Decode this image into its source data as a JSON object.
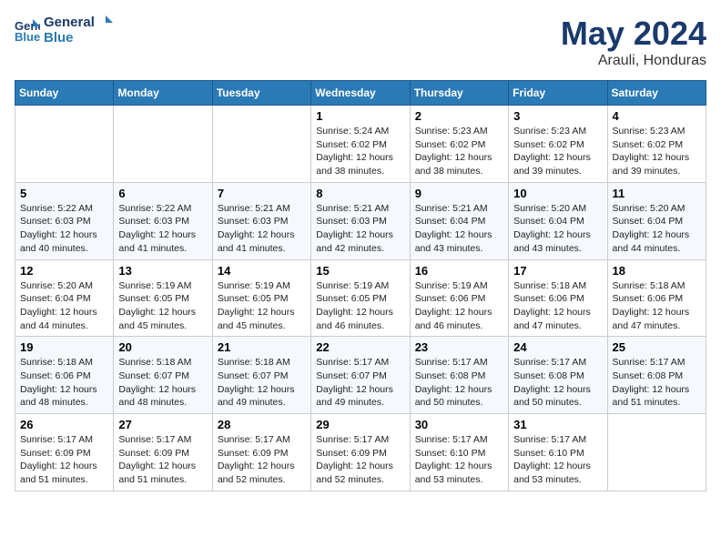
{
  "logo": {
    "line1": "General",
    "line2": "Blue"
  },
  "title": "May 2024",
  "subtitle": "Arauli, Honduras",
  "weekdays": [
    "Sunday",
    "Monday",
    "Tuesday",
    "Wednesday",
    "Thursday",
    "Friday",
    "Saturday"
  ],
  "weeks": [
    [
      {
        "day": "",
        "info": ""
      },
      {
        "day": "",
        "info": ""
      },
      {
        "day": "",
        "info": ""
      },
      {
        "day": "1",
        "info": "Sunrise: 5:24 AM\nSunset: 6:02 PM\nDaylight: 12 hours\nand 38 minutes."
      },
      {
        "day": "2",
        "info": "Sunrise: 5:23 AM\nSunset: 6:02 PM\nDaylight: 12 hours\nand 38 minutes."
      },
      {
        "day": "3",
        "info": "Sunrise: 5:23 AM\nSunset: 6:02 PM\nDaylight: 12 hours\nand 39 minutes."
      },
      {
        "day": "4",
        "info": "Sunrise: 5:23 AM\nSunset: 6:02 PM\nDaylight: 12 hours\nand 39 minutes."
      }
    ],
    [
      {
        "day": "5",
        "info": "Sunrise: 5:22 AM\nSunset: 6:03 PM\nDaylight: 12 hours\nand 40 minutes."
      },
      {
        "day": "6",
        "info": "Sunrise: 5:22 AM\nSunset: 6:03 PM\nDaylight: 12 hours\nand 41 minutes."
      },
      {
        "day": "7",
        "info": "Sunrise: 5:21 AM\nSunset: 6:03 PM\nDaylight: 12 hours\nand 41 minutes."
      },
      {
        "day": "8",
        "info": "Sunrise: 5:21 AM\nSunset: 6:03 PM\nDaylight: 12 hours\nand 42 minutes."
      },
      {
        "day": "9",
        "info": "Sunrise: 5:21 AM\nSunset: 6:04 PM\nDaylight: 12 hours\nand 43 minutes."
      },
      {
        "day": "10",
        "info": "Sunrise: 5:20 AM\nSunset: 6:04 PM\nDaylight: 12 hours\nand 43 minutes."
      },
      {
        "day": "11",
        "info": "Sunrise: 5:20 AM\nSunset: 6:04 PM\nDaylight: 12 hours\nand 44 minutes."
      }
    ],
    [
      {
        "day": "12",
        "info": "Sunrise: 5:20 AM\nSunset: 6:04 PM\nDaylight: 12 hours\nand 44 minutes."
      },
      {
        "day": "13",
        "info": "Sunrise: 5:19 AM\nSunset: 6:05 PM\nDaylight: 12 hours\nand 45 minutes."
      },
      {
        "day": "14",
        "info": "Sunrise: 5:19 AM\nSunset: 6:05 PM\nDaylight: 12 hours\nand 45 minutes."
      },
      {
        "day": "15",
        "info": "Sunrise: 5:19 AM\nSunset: 6:05 PM\nDaylight: 12 hours\nand 46 minutes."
      },
      {
        "day": "16",
        "info": "Sunrise: 5:19 AM\nSunset: 6:06 PM\nDaylight: 12 hours\nand 46 minutes."
      },
      {
        "day": "17",
        "info": "Sunrise: 5:18 AM\nSunset: 6:06 PM\nDaylight: 12 hours\nand 47 minutes."
      },
      {
        "day": "18",
        "info": "Sunrise: 5:18 AM\nSunset: 6:06 PM\nDaylight: 12 hours\nand 47 minutes."
      }
    ],
    [
      {
        "day": "19",
        "info": "Sunrise: 5:18 AM\nSunset: 6:06 PM\nDaylight: 12 hours\nand 48 minutes."
      },
      {
        "day": "20",
        "info": "Sunrise: 5:18 AM\nSunset: 6:07 PM\nDaylight: 12 hours\nand 48 minutes."
      },
      {
        "day": "21",
        "info": "Sunrise: 5:18 AM\nSunset: 6:07 PM\nDaylight: 12 hours\nand 49 minutes."
      },
      {
        "day": "22",
        "info": "Sunrise: 5:17 AM\nSunset: 6:07 PM\nDaylight: 12 hours\nand 49 minutes."
      },
      {
        "day": "23",
        "info": "Sunrise: 5:17 AM\nSunset: 6:08 PM\nDaylight: 12 hours\nand 50 minutes."
      },
      {
        "day": "24",
        "info": "Sunrise: 5:17 AM\nSunset: 6:08 PM\nDaylight: 12 hours\nand 50 minutes."
      },
      {
        "day": "25",
        "info": "Sunrise: 5:17 AM\nSunset: 6:08 PM\nDaylight: 12 hours\nand 51 minutes."
      }
    ],
    [
      {
        "day": "26",
        "info": "Sunrise: 5:17 AM\nSunset: 6:09 PM\nDaylight: 12 hours\nand 51 minutes."
      },
      {
        "day": "27",
        "info": "Sunrise: 5:17 AM\nSunset: 6:09 PM\nDaylight: 12 hours\nand 51 minutes."
      },
      {
        "day": "28",
        "info": "Sunrise: 5:17 AM\nSunset: 6:09 PM\nDaylight: 12 hours\nand 52 minutes."
      },
      {
        "day": "29",
        "info": "Sunrise: 5:17 AM\nSunset: 6:09 PM\nDaylight: 12 hours\nand 52 minutes."
      },
      {
        "day": "30",
        "info": "Sunrise: 5:17 AM\nSunset: 6:10 PM\nDaylight: 12 hours\nand 53 minutes."
      },
      {
        "day": "31",
        "info": "Sunrise: 5:17 AM\nSunset: 6:10 PM\nDaylight: 12 hours\nand 53 minutes."
      },
      {
        "day": "",
        "info": ""
      }
    ]
  ]
}
